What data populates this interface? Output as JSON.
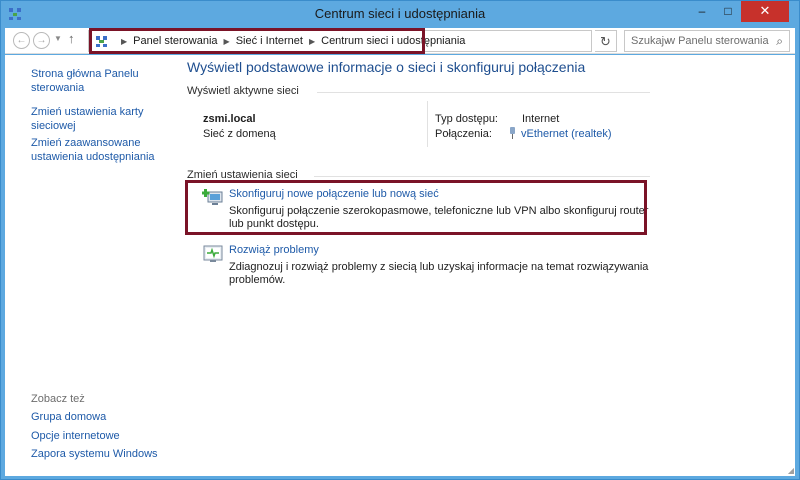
{
  "window": {
    "title": "Centrum sieci i udostępniania",
    "minimize_icon": "minimize-icon",
    "maximize_icon": "maximize-icon",
    "close_icon": "close-icon"
  },
  "nav": {
    "back_icon": "back-arrow-icon",
    "forward_icon": "forward-arrow-icon",
    "up_icon": "up-arrow-icon"
  },
  "breadcrumb": {
    "items": [
      "Panel sterowania",
      "Sieć i Internet",
      "Centrum sieci i udostępniania"
    ]
  },
  "search": {
    "placeholder": "Szukaj w Panelu sterowania"
  },
  "sidebar": {
    "links": [
      "Strona główna Panelu sterowania",
      "Zmień ustawienia karty sieciowej",
      "Zmień zaawansowane ustawienia udostępniania"
    ],
    "see_also_label": "Zobacz też",
    "see_also": [
      "Grupa domowa",
      "Opcje internetowe",
      "Zapora systemu Windows"
    ]
  },
  "main": {
    "heading": "Wyświetl podstawowe informacje o sieci i skonfiguruj połączenia",
    "active_networks_label": "Wyświetl aktywne sieci",
    "network": {
      "name": "zsmi.local",
      "type": "Sieć z domeną",
      "access_type_label": "Typ dostępu:",
      "access_type_value": "Internet",
      "connections_label": "Połączenia:",
      "connections_value": "vEthernet (realtek)"
    },
    "change_settings_label": "Zmień ustawienia sieci",
    "tasks": [
      {
        "title": "Skonfiguruj nowe połączenie lub nową sieć",
        "desc": "Skonfiguruj połączenie szerokopasmowe, telefoniczne lub VPN albo skonfiguruj router lub punkt dostępu.",
        "icon": "new-connection-icon"
      },
      {
        "title": "Rozwiąż problemy",
        "desc": "Zdiagnozuj i rozwiąż problemy z siecią lub uzyskaj informacje na temat rozwiązywania problemów.",
        "icon": "troubleshoot-icon"
      }
    ]
  },
  "colors": {
    "highlight_border": "#7a1327",
    "link": "#1e5aa8",
    "window_frame": "#5da9e0"
  }
}
